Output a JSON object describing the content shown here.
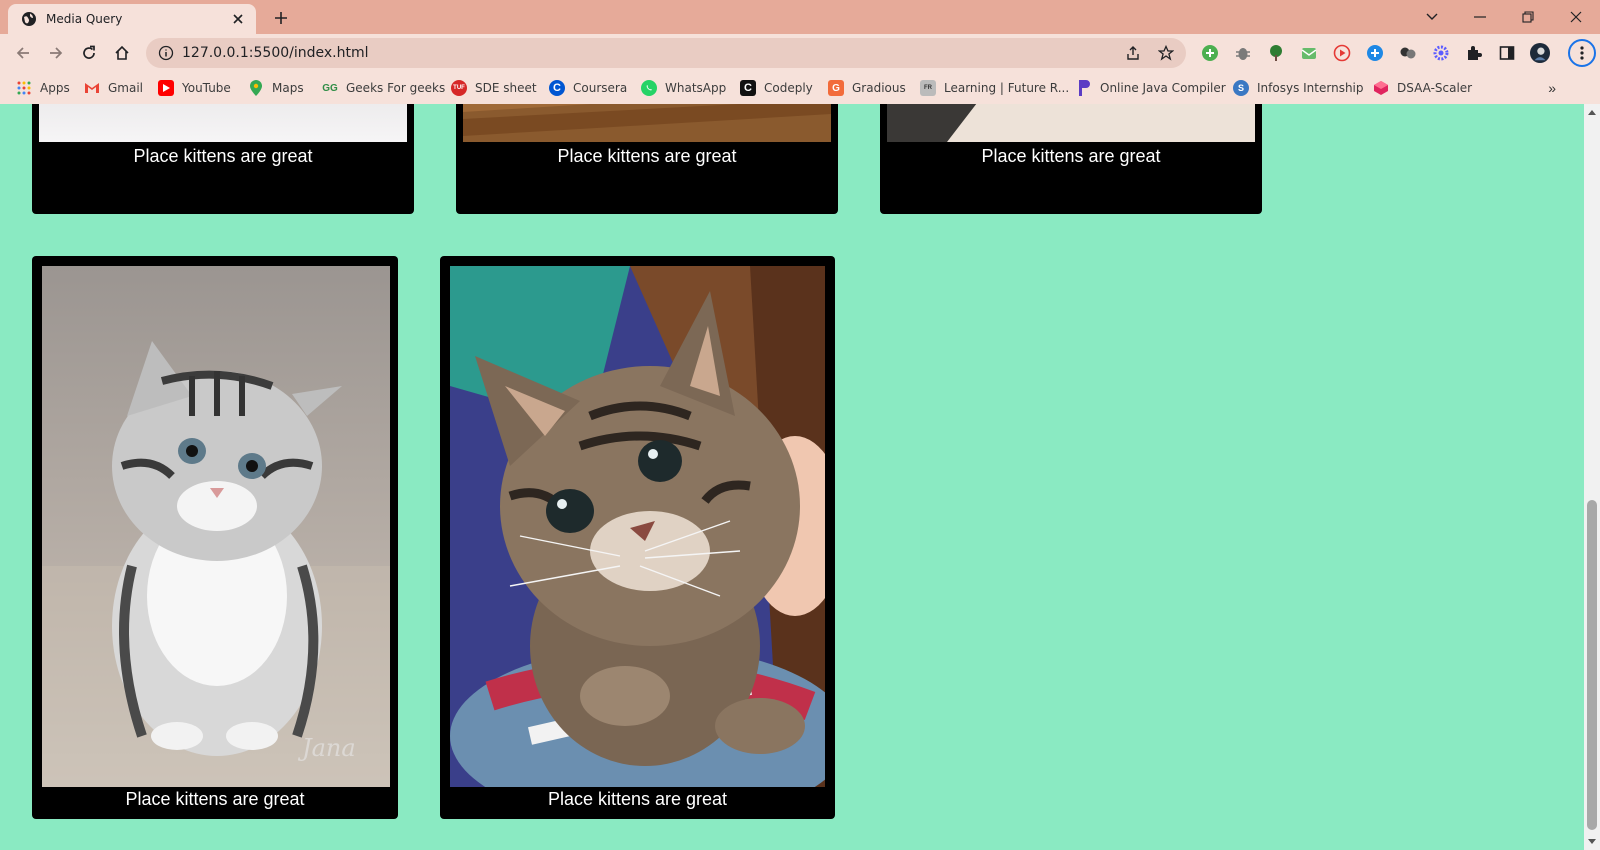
{
  "window": {
    "tab_title": "Media Query",
    "tab_favicon": "globe-icon"
  },
  "toolbar": {
    "url": "127.0.0.1:5500/index.html"
  },
  "bookmarks": [
    {
      "label": "Apps",
      "icon": "apps-grid-icon",
      "color": "#4285f4"
    },
    {
      "label": "Gmail",
      "icon": "gmail-icon",
      "color": "#ea4335"
    },
    {
      "label": "YouTube",
      "icon": "youtube-icon",
      "color": "#ff0000"
    },
    {
      "label": "Maps",
      "icon": "maps-icon",
      "color": "#34a853"
    },
    {
      "label": "Geeks For geeks",
      "icon": "gfg-icon",
      "color": "#2f8d46"
    },
    {
      "label": "SDE sheet",
      "icon": "tuf-icon",
      "color": "#d62828"
    },
    {
      "label": "Coursera",
      "icon": "coursera-icon",
      "color": "#0056d2"
    },
    {
      "label": "WhatsApp",
      "icon": "whatsapp-icon",
      "color": "#25d366"
    },
    {
      "label": "Codeply",
      "icon": "codeply-icon",
      "color": "#111111"
    },
    {
      "label": "Gradious",
      "icon": "gradious-icon",
      "color": "#f26b3a"
    },
    {
      "label": "Learning | Future R...",
      "icon": "futurerready-icon",
      "color": "#888888"
    },
    {
      "label": "Online Java Compiler",
      "icon": "programiz-icon",
      "color": "#5b3cc4"
    },
    {
      "label": "Infosys Internship",
      "icon": "infosys-icon",
      "color": "#3a78c3"
    },
    {
      "label": "DSAA-Scaler",
      "icon": "scaler-icon",
      "color": "#e0245e"
    }
  ],
  "page": {
    "background": "#8aeac2",
    "cards": [
      {
        "caption": "Place kittens are great"
      },
      {
        "caption": "Place kittens are great"
      },
      {
        "caption": "Place kittens are great"
      },
      {
        "caption": "Place kittens are great"
      },
      {
        "caption": "Place kittens are great"
      }
    ]
  }
}
